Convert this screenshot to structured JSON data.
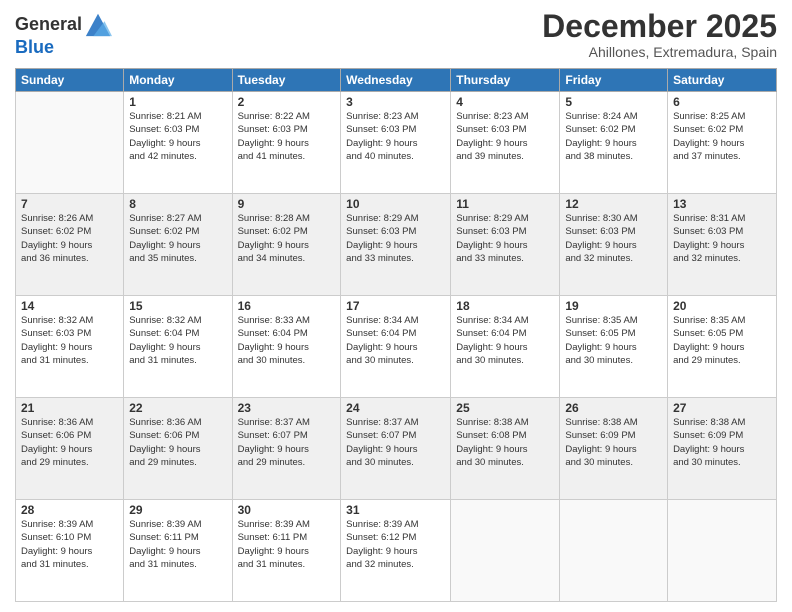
{
  "logo": {
    "general": "General",
    "blue": "Blue"
  },
  "header": {
    "month": "December 2025",
    "location": "Ahillones, Extremadura, Spain"
  },
  "weekdays": [
    "Sunday",
    "Monday",
    "Tuesday",
    "Wednesday",
    "Thursday",
    "Friday",
    "Saturday"
  ],
  "weeks": [
    {
      "shaded": false,
      "days": [
        {
          "num": "",
          "info": ""
        },
        {
          "num": "1",
          "info": "Sunrise: 8:21 AM\nSunset: 6:03 PM\nDaylight: 9 hours\nand 42 minutes."
        },
        {
          "num": "2",
          "info": "Sunrise: 8:22 AM\nSunset: 6:03 PM\nDaylight: 9 hours\nand 41 minutes."
        },
        {
          "num": "3",
          "info": "Sunrise: 8:23 AM\nSunset: 6:03 PM\nDaylight: 9 hours\nand 40 minutes."
        },
        {
          "num": "4",
          "info": "Sunrise: 8:23 AM\nSunset: 6:03 PM\nDaylight: 9 hours\nand 39 minutes."
        },
        {
          "num": "5",
          "info": "Sunrise: 8:24 AM\nSunset: 6:02 PM\nDaylight: 9 hours\nand 38 minutes."
        },
        {
          "num": "6",
          "info": "Sunrise: 8:25 AM\nSunset: 6:02 PM\nDaylight: 9 hours\nand 37 minutes."
        }
      ]
    },
    {
      "shaded": true,
      "days": [
        {
          "num": "7",
          "info": "Sunrise: 8:26 AM\nSunset: 6:02 PM\nDaylight: 9 hours\nand 36 minutes."
        },
        {
          "num": "8",
          "info": "Sunrise: 8:27 AM\nSunset: 6:02 PM\nDaylight: 9 hours\nand 35 minutes."
        },
        {
          "num": "9",
          "info": "Sunrise: 8:28 AM\nSunset: 6:02 PM\nDaylight: 9 hours\nand 34 minutes."
        },
        {
          "num": "10",
          "info": "Sunrise: 8:29 AM\nSunset: 6:03 PM\nDaylight: 9 hours\nand 33 minutes."
        },
        {
          "num": "11",
          "info": "Sunrise: 8:29 AM\nSunset: 6:03 PM\nDaylight: 9 hours\nand 33 minutes."
        },
        {
          "num": "12",
          "info": "Sunrise: 8:30 AM\nSunset: 6:03 PM\nDaylight: 9 hours\nand 32 minutes."
        },
        {
          "num": "13",
          "info": "Sunrise: 8:31 AM\nSunset: 6:03 PM\nDaylight: 9 hours\nand 32 minutes."
        }
      ]
    },
    {
      "shaded": false,
      "days": [
        {
          "num": "14",
          "info": "Sunrise: 8:32 AM\nSunset: 6:03 PM\nDaylight: 9 hours\nand 31 minutes."
        },
        {
          "num": "15",
          "info": "Sunrise: 8:32 AM\nSunset: 6:04 PM\nDaylight: 9 hours\nand 31 minutes."
        },
        {
          "num": "16",
          "info": "Sunrise: 8:33 AM\nSunset: 6:04 PM\nDaylight: 9 hours\nand 30 minutes."
        },
        {
          "num": "17",
          "info": "Sunrise: 8:34 AM\nSunset: 6:04 PM\nDaylight: 9 hours\nand 30 minutes."
        },
        {
          "num": "18",
          "info": "Sunrise: 8:34 AM\nSunset: 6:04 PM\nDaylight: 9 hours\nand 30 minutes."
        },
        {
          "num": "19",
          "info": "Sunrise: 8:35 AM\nSunset: 6:05 PM\nDaylight: 9 hours\nand 30 minutes."
        },
        {
          "num": "20",
          "info": "Sunrise: 8:35 AM\nSunset: 6:05 PM\nDaylight: 9 hours\nand 29 minutes."
        }
      ]
    },
    {
      "shaded": true,
      "days": [
        {
          "num": "21",
          "info": "Sunrise: 8:36 AM\nSunset: 6:06 PM\nDaylight: 9 hours\nand 29 minutes."
        },
        {
          "num": "22",
          "info": "Sunrise: 8:36 AM\nSunset: 6:06 PM\nDaylight: 9 hours\nand 29 minutes."
        },
        {
          "num": "23",
          "info": "Sunrise: 8:37 AM\nSunset: 6:07 PM\nDaylight: 9 hours\nand 29 minutes."
        },
        {
          "num": "24",
          "info": "Sunrise: 8:37 AM\nSunset: 6:07 PM\nDaylight: 9 hours\nand 30 minutes."
        },
        {
          "num": "25",
          "info": "Sunrise: 8:38 AM\nSunset: 6:08 PM\nDaylight: 9 hours\nand 30 minutes."
        },
        {
          "num": "26",
          "info": "Sunrise: 8:38 AM\nSunset: 6:09 PM\nDaylight: 9 hours\nand 30 minutes."
        },
        {
          "num": "27",
          "info": "Sunrise: 8:38 AM\nSunset: 6:09 PM\nDaylight: 9 hours\nand 30 minutes."
        }
      ]
    },
    {
      "shaded": false,
      "days": [
        {
          "num": "28",
          "info": "Sunrise: 8:39 AM\nSunset: 6:10 PM\nDaylight: 9 hours\nand 31 minutes."
        },
        {
          "num": "29",
          "info": "Sunrise: 8:39 AM\nSunset: 6:11 PM\nDaylight: 9 hours\nand 31 minutes."
        },
        {
          "num": "30",
          "info": "Sunrise: 8:39 AM\nSunset: 6:11 PM\nDaylight: 9 hours\nand 31 minutes."
        },
        {
          "num": "31",
          "info": "Sunrise: 8:39 AM\nSunset: 6:12 PM\nDaylight: 9 hours\nand 32 minutes."
        },
        {
          "num": "",
          "info": ""
        },
        {
          "num": "",
          "info": ""
        },
        {
          "num": "",
          "info": ""
        }
      ]
    }
  ]
}
